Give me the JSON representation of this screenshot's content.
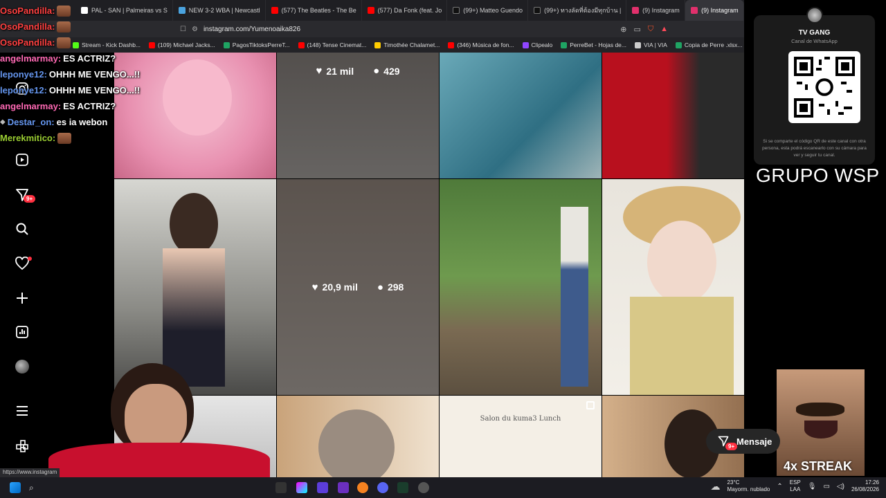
{
  "browser": {
    "tabs": [
      {
        "label": "PAL - SAN | Palmeiras vs S",
        "color": "#ffffff"
      },
      {
        "label": "NEW 3-2 WBA | Newcastl",
        "color": "#4aa3df"
      },
      {
        "label": "(577) The Beatles - The Be",
        "color": "#ff0000"
      },
      {
        "label": "(577) Da Fonk (feat. Jo",
        "color": "#ff0000"
      },
      {
        "label": "(99+) Matteo Guendo",
        "color": "#ffffff"
      },
      {
        "label": "(99+) ทางลัดที่ต้องมีทุกบ้าน |",
        "color": "#ffffff"
      },
      {
        "label": "(9) Instagram",
        "color": "#e1306c"
      }
    ],
    "active_tab": "(9) Instagram",
    "url": "instagram.com/Yumenoaika826",
    "bookmarks": [
      {
        "label": "Stream - Kick Dashb...",
        "color": "#53fc18"
      },
      {
        "label": "(109) Michael Jacks...",
        "color": "#ff0000"
      },
      {
        "label": "PagosTiktoksPerreT...",
        "color": "#1fa463"
      },
      {
        "label": "(148) Tense Cinemat...",
        "color": "#ff0000"
      },
      {
        "label": "Timothée Chalamet...",
        "color": "#ffcc00"
      },
      {
        "label": "(346) Música de fon...",
        "color": "#ff0000"
      },
      {
        "label": "Clipealo",
        "color": "#9146ff"
      },
      {
        "label": "PerreBet - Hojas de...",
        "color": "#1fa463"
      },
      {
        "label": "VIA | VIA",
        "color": "#cccccc"
      },
      {
        "label": "Copia de Perre .xlsx...",
        "color": "#1fa463"
      }
    ],
    "status_url": "https://www.instagram"
  },
  "chat": [
    {
      "user": "OsoPandilla:",
      "color": "#ff4040",
      "text": ""
    },
    {
      "user": "OsoPandilla:",
      "color": "#ff4040",
      "text": ""
    },
    {
      "user": "OsoPandilla:",
      "color": "#ff4040",
      "text": ""
    },
    {
      "user": "angelmarmay:",
      "color": "#ff69b4",
      "text": "ES ACTRIZ?"
    },
    {
      "user": "leponye12:",
      "color": "#6495ed",
      "text": "OHHH ME VENGO...!!"
    },
    {
      "user": "leponye12:",
      "color": "#6495ed",
      "text": "OHHH ME VENGO...!!"
    },
    {
      "user": "angelmarmay:",
      "color": "#ff69b4",
      "text": "ES ACTRIZ?"
    },
    {
      "user": "Destar_on:",
      "color": "#6495ed",
      "text": "es ia webon"
    },
    {
      "user": "Merekmitico:",
      "color": "#9acd32",
      "text": ""
    }
  ],
  "posts": {
    "top_overlay": {
      "likes": "21 mil",
      "comments": "429"
    },
    "mid_overlay": {
      "likes": "20,9 mil",
      "comments": "298"
    }
  },
  "nav": {
    "notifications_badge": "9+"
  },
  "whatsapp_card": {
    "name": "TV GANG",
    "subtitle": "Canal de WhatsApp",
    "note": "Si se comparte el código QR de este canal con otra persona, esta podrá escanearlo con su cámara para ver y seguir tu canal."
  },
  "overlay_text": {
    "grupo": "GRUPO WSP",
    "streak": "4x STREAK"
  },
  "messages_button": {
    "label": "Mensaje",
    "badge": "9+"
  },
  "menu_label": "Salon du kuma3 Lunch",
  "taskbar": {
    "language": "ESP",
    "region": "LAA",
    "weather_temp": "23°C",
    "weather_desc": "Mayorm. nublado",
    "time": "17:26",
    "date": "26/08/2026"
  }
}
